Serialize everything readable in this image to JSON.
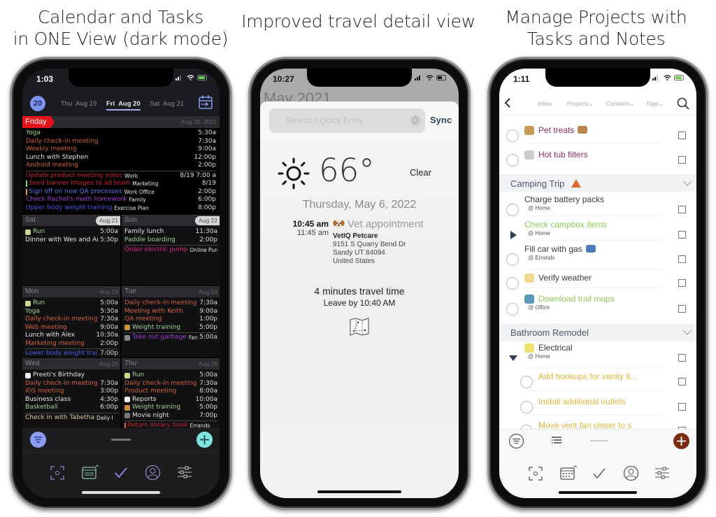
{
  "headings": {
    "left": [
      "Calendar and Tasks",
      "in ONE View (dark mode)"
    ],
    "middle": [
      "Improved travel detail view"
    ],
    "right": [
      "Manage Projects with",
      "Tasks and Notes"
    ]
  },
  "calendar_phone": {
    "status_time": "1:03",
    "today_badge": "20",
    "day_tabs": [
      "Thu  Aug 19",
      "Fri  Aug 20",
      "Sat  Aug 21"
    ],
    "colors": {
      "accent": "#8b9cf0",
      "today_red": "#e5141b",
      "add_button": "#7fe3df"
    },
    "friday": {
      "label": "Friday",
      "date": "Aug 20, 2021",
      "events": [
        {
          "title": "Yoga",
          "time": "5:30a",
          "color": "#9cd08e"
        },
        {
          "title": "Daily check-in meeting",
          "time": "7:30a",
          "color": "#d4603a"
        },
        {
          "title": "Weekly meeting",
          "time": "9:00a",
          "color": "#d4603a"
        },
        {
          "title": "Lunch with Stephen",
          "time": "12:00p",
          "color": "#e6e6e6"
        },
        {
          "title": "Android meeting",
          "time": "2:00p",
          "color": "#d4603a"
        }
      ],
      "tasks": [
        {
          "title": "Update product meeting notes",
          "tag": "Work",
          "time": "8/19 7:00 a",
          "color": "#c8242c"
        },
        {
          "title": "Send banner images to ad team",
          "tag": "Marketing",
          "time": "8/19",
          "color": "#c8242c",
          "bar": "#7ee07a"
        },
        {
          "title": "Sign off on new QA processes",
          "tag": "Work  Office",
          "time": "2:00p",
          "color": "#5f73e6",
          "bar": "#e49b3a"
        },
        {
          "title": "Check Rachel's math homework",
          "tag": "Family",
          "time": "6:00p",
          "color": "#a23bd6"
        },
        {
          "title": "Upper body weight training",
          "tag": "Exercise Plan",
          "time": "8:00p",
          "color": "#4f55e6"
        }
      ]
    },
    "days": [
      {
        "name": "Sat",
        "date": "Aug 21",
        "weekend": true,
        "events": [
          {
            "title": "Run",
            "time": "5:00a",
            "color": "#9cd08e",
            "icon": "runner"
          },
          {
            "title": "Dinner with Wes and Am",
            "time": "5:30p",
            "color": "#e6e6e6"
          }
        ],
        "tasks": []
      },
      {
        "name": "Sun",
        "date": "Aug 22",
        "weekend": true,
        "events": [
          {
            "title": "Family lunch",
            "time": "11:30a",
            "color": "#e6e6e6"
          },
          {
            "title": "Paddle boarding",
            "time": "2:00p",
            "color": "#9cd08e"
          }
        ],
        "tasks": [
          {
            "title": "Order electric pump",
            "tag": "Online Purc",
            "time": "",
            "color": "#d6227e"
          }
        ]
      },
      {
        "name": "Mon",
        "date": "Aug 23",
        "events": [
          {
            "title": "Run",
            "time": "5:00a",
            "color": "#9cd08e",
            "icon": "runner"
          },
          {
            "title": "Yoga",
            "time": "5:30a",
            "color": "#9cd08e"
          },
          {
            "title": "Daily check-in meeting",
            "time": "7:30a",
            "color": "#d4603a"
          },
          {
            "title": "Web meeting",
            "time": "9:00a",
            "color": "#d4603a"
          },
          {
            "title": "Lunch with Alex",
            "time": "10:30a",
            "color": "#e6e6e6"
          },
          {
            "title": "Marketing meeting",
            "time": "2:00p",
            "color": "#d4603a"
          }
        ],
        "tasks": [
          {
            "title": "Lower body weight traini",
            "tag": "",
            "time": "7:00p",
            "color": "#4f55e6"
          }
        ]
      },
      {
        "name": "Tue",
        "date": "Aug 24",
        "events": [
          {
            "title": "Daily check-in meeting",
            "time": "7:30a",
            "color": "#d4603a"
          },
          {
            "title": "Meeting with Keith",
            "time": "9:00a",
            "color": "#d4603a"
          },
          {
            "title": "QA meeting",
            "time": "1:00p",
            "color": "#d4603a"
          },
          {
            "title": "Weight training",
            "time": "5:00p",
            "color": "#9cd08e",
            "icon": "weights"
          }
        ],
        "tasks": [
          {
            "title": "Take out garbage",
            "tag": "Fan",
            "time": "5:00a",
            "color": "#a23bd6",
            "icon": "trash"
          }
        ]
      },
      {
        "name": "Wed",
        "date": "Aug 25",
        "events": [
          {
            "title": "Preeti's Birthday",
            "time": "",
            "color": "#e6e6e6",
            "icon": "cake"
          },
          {
            "title": "Daily check-in meeting",
            "time": "7:30a",
            "color": "#d4603a"
          },
          {
            "title": "iOS meeting",
            "time": "3:00p",
            "color": "#d4603a"
          },
          {
            "title": "Business class",
            "time": "4:30p",
            "color": "#e6e6e6"
          },
          {
            "title": "Basketball",
            "time": "6:00p",
            "color": "#9cd08e"
          }
        ],
        "tasks": [
          {
            "title": "Check in with Tabetha",
            "tag": "Daily I",
            "time": "",
            "color": "#d9cc98"
          }
        ]
      },
      {
        "name": "Thu",
        "date": "Aug 26",
        "events": [
          {
            "title": "Run",
            "time": "5:00a",
            "color": "#9cd08e",
            "icon": "runner"
          },
          {
            "title": "Daily check-in meeting",
            "time": "7:30a",
            "color": "#d4603a"
          },
          {
            "title": "Product meeting",
            "time": "8:00a",
            "color": "#d4603a"
          },
          {
            "title": "Reports",
            "time": "10:00a",
            "color": "#e6e6e6",
            "icon": "chart"
          },
          {
            "title": "Weight training",
            "time": "5:00p",
            "color": "#9cd08e",
            "icon": "weights"
          },
          {
            "title": "Movie night",
            "time": "7:00p",
            "color": "#e6e6e6",
            "icon": "popcorn"
          }
        ],
        "tasks": [
          {
            "title": "Return library book",
            "tag": "Errands",
            "time": "",
            "color": "#c8242c",
            "bar": "#e0603a"
          }
        ]
      }
    ],
    "tab_icons": [
      "scan-icon",
      "calendar-icon",
      "checkmark-icon",
      "person-icon",
      "sliders-icon"
    ]
  },
  "travel_phone": {
    "status_time": "10:27",
    "background_month": "May 2021",
    "search_placeholder": "Search / Quick Entry",
    "sync_label": "Sync",
    "weather": {
      "temperature": "66°",
      "condition": "Clear",
      "icon": "sun-icon"
    },
    "date": "Thursday, May 6, 2022",
    "event": {
      "start": "10:45 am",
      "end": "11:45 am",
      "title": "Vet appointment",
      "icon": "dog-icon",
      "location_name": "VetIQ Petcare",
      "address": [
        "9151 S Quarry Bend Dr",
        "Sandy UT 84094",
        "United States"
      ]
    },
    "travel_time": "4 minutes travel time",
    "leave_by": "Leave by 10:40 AM"
  },
  "projects_phone": {
    "status_time": "1:11",
    "nav_tabs": [
      "Inbox",
      "Projects⌄",
      "Contexts⌄",
      "Tags⌄"
    ],
    "accent_add": "#7a2c12",
    "top_tasks": [
      {
        "title": "Pet treats",
        "color": "#8a2c5e",
        "icon": "cat-icon",
        "trail_icon": "dog-icon"
      },
      {
        "title": "Hot tub filters",
        "color": "#8a2c5e",
        "icon": "bathtub-icon"
      }
    ],
    "sections": [
      {
        "title": "Camping Trip",
        "icon": "tent-icon",
        "tasks": [
          {
            "title": "Charge battery packs",
            "context": "@ Home",
            "color": "#3a3a3a"
          },
          {
            "title": "Check campbox items",
            "context": "@ Home",
            "color": "#8fc958",
            "expandable": "collapsed"
          },
          {
            "title": "Fill car with gas",
            "context": "@ Errands",
            "color": "#3a3a3a",
            "trail_icon": "car-icon"
          },
          {
            "title": "Verify weather",
            "color": "#3a3a3a",
            "icon": "cloud-icon"
          },
          {
            "title": "Download trail maps",
            "context": "@ Office",
            "color": "#8fc958",
            "icon": "map-icon"
          }
        ]
      },
      {
        "title": "Bathroom Remodel",
        "tasks": [
          {
            "title": "Electrical",
            "context": "@ Home",
            "color": "#3a3a3a",
            "icon": "lightbulb-icon",
            "expandable": "expanded"
          },
          {
            "title": "Add hookups for vanity li...",
            "color": "#e0b43c",
            "sub": true
          },
          {
            "title": "Install additional outlets",
            "color": "#e0b43c",
            "sub": true
          },
          {
            "title": "Move vent fan closer to s",
            "color": "#e0b43c",
            "sub": true
          }
        ]
      }
    ]
  }
}
